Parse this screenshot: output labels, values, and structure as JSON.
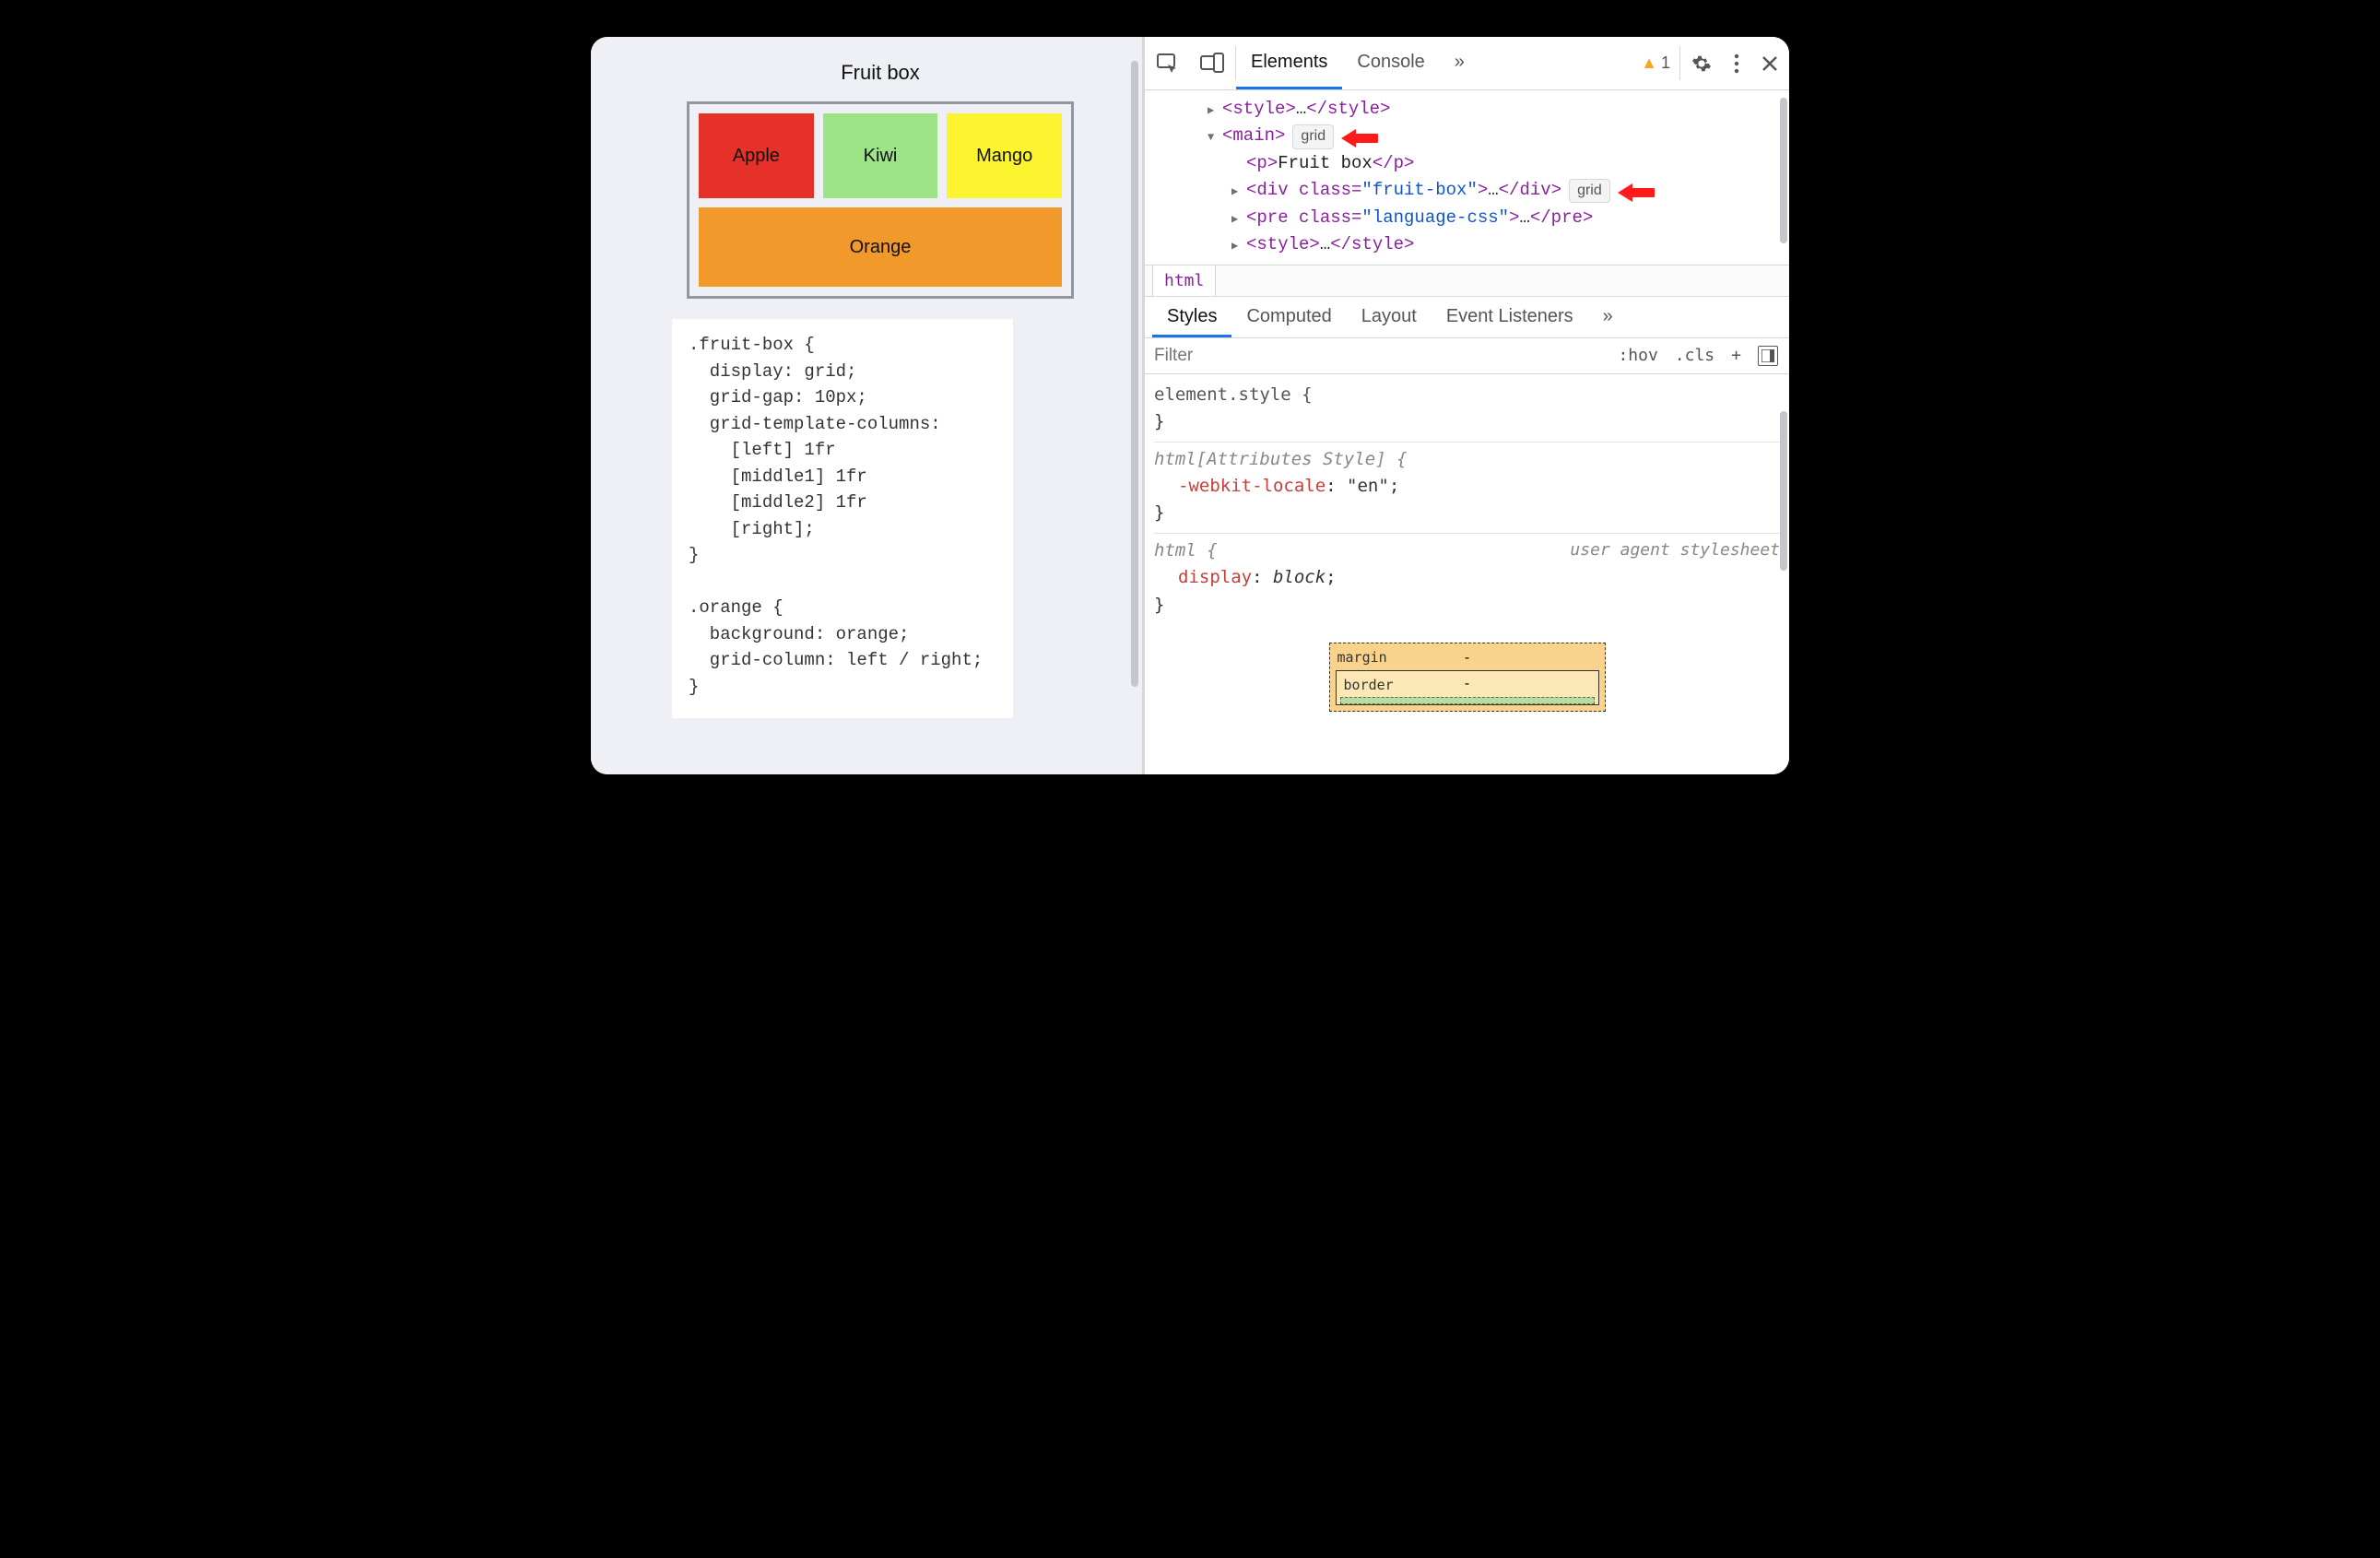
{
  "left": {
    "title": "Fruit box",
    "fruits": {
      "apple": "Apple",
      "kiwi": "Kiwi",
      "mango": "Mango",
      "orange": "Orange"
    },
    "css_code": ".fruit-box {\n  display: grid;\n  grid-gap: 10px;\n  grid-template-columns:\n    [left] 1fr\n    [middle1] 1fr\n    [middle2] 1fr\n    [right];\n}\n\n.orange {\n  background: orange;\n  grid-column: left / right;\n}"
  },
  "devtools": {
    "tabs": {
      "elements": "Elements",
      "console": "Console",
      "more": "»"
    },
    "warning_count": "1",
    "dom": {
      "l1": {
        "open": "<style>",
        "mid": "…",
        "close": "</style>"
      },
      "l2": {
        "open": "<main>",
        "badge": "grid"
      },
      "l3": {
        "open": "<p>",
        "text": "Fruit box",
        "close": "</p>"
      },
      "l4": {
        "open": "<div class=",
        "attrval": "\"fruit-box\"",
        "openend": ">",
        "mid": "…",
        "close": "</div>",
        "badge": "grid"
      },
      "l5": {
        "open": "<pre class=",
        "attrval": "\"language-css\"",
        "openend": ">",
        "mid": "…",
        "close": "</pre>"
      },
      "l6": {
        "open": "<style>",
        "mid": "…",
        "close": "</style>"
      }
    },
    "breadcrumb": "html",
    "style_tabs": {
      "styles": "Styles",
      "computed": "Computed",
      "layout": "Layout",
      "events": "Event Listeners",
      "more": "»"
    },
    "filter_placeholder": "Filter",
    "filter_tools": {
      "hov": ":hov",
      "cls": ".cls",
      "plus": "+"
    },
    "rules": {
      "r1_sel": "element.style {",
      "r1_close": "}",
      "r2_sel": "html[Attributes Style] {",
      "r2_prop": "-webkit-locale",
      "r2_val": "\"en\"",
      "r2_close": "}",
      "r3_sel": "html {",
      "r3_ua": "user agent stylesheet",
      "r3_prop": "display",
      "r3_val": "block",
      "r3_close": "}"
    },
    "boxmodel": {
      "margin": "margin",
      "border": "border",
      "dash": "-"
    }
  }
}
